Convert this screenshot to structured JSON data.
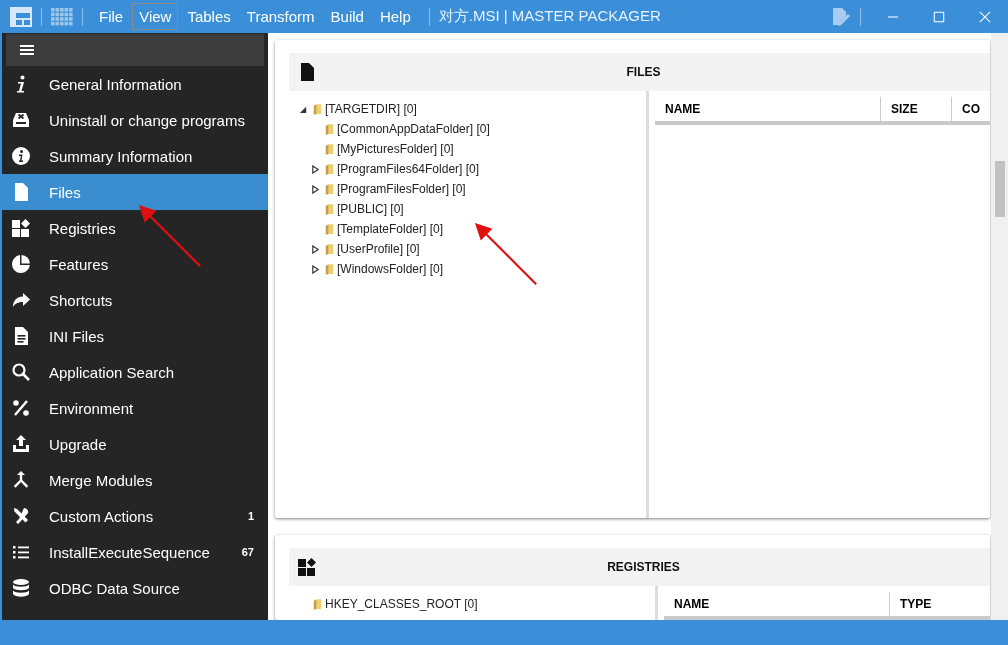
{
  "window": {
    "title": "对方.MSI | MASTER PACKAGER"
  },
  "menu": [
    {
      "label": "File",
      "selected": false
    },
    {
      "label": "View",
      "selected": true
    },
    {
      "label": "Tables",
      "selected": false
    },
    {
      "label": "Transform",
      "selected": false
    },
    {
      "label": "Build",
      "selected": false
    },
    {
      "label": "Help",
      "selected": false
    }
  ],
  "sidebar": {
    "items": [
      {
        "label": "General Information",
        "kind": "info-letter",
        "selected": false
      },
      {
        "label": "Uninstall or change programs",
        "kind": "uninstall",
        "selected": false
      },
      {
        "label": "Summary Information",
        "kind": "info-circle",
        "selected": false
      },
      {
        "label": "Files",
        "kind": "file",
        "selected": true
      },
      {
        "label": "Registries",
        "kind": "registry",
        "selected": false
      },
      {
        "label": "Features",
        "kind": "pie",
        "selected": false
      },
      {
        "label": "Shortcuts",
        "kind": "share",
        "selected": false
      },
      {
        "label": "INI Files",
        "kind": "doc",
        "selected": false
      },
      {
        "label": "Application Search",
        "kind": "search",
        "selected": false
      },
      {
        "label": "Environment",
        "kind": "percent",
        "selected": false
      },
      {
        "label": "Upgrade",
        "kind": "upload",
        "selected": false
      },
      {
        "label": "Merge Modules",
        "kind": "merge",
        "selected": false
      },
      {
        "label": "Custom Actions",
        "kind": "tools",
        "selected": false,
        "badge": "1"
      },
      {
        "label": "InstallExecuteSequence",
        "kind": "list",
        "selected": false,
        "badge": "67"
      },
      {
        "label": "ODBC Data Source",
        "kind": "database",
        "selected": false
      }
    ]
  },
  "files": {
    "title": "FILES",
    "tree": [
      {
        "label": "[TARGETDIR] [0]",
        "expanded": true,
        "children": [
          {
            "label": "[CommonAppDataFolder] [0]"
          },
          {
            "label": "[MyPicturesFolder] [0]"
          },
          {
            "label": "[ProgramFiles64Folder] [0]",
            "expanded": false
          },
          {
            "label": "[ProgramFilesFolder] [0]",
            "expanded": false
          },
          {
            "label": "[PUBLIC] [0]"
          },
          {
            "label": "[TemplateFolder] [0]"
          },
          {
            "label": "[UserProfile] [0]",
            "expanded": false
          },
          {
            "label": "[WindowsFolder] [0]",
            "expanded": false
          }
        ]
      }
    ],
    "columns": [
      "NAME",
      "SIZE",
      "CO"
    ]
  },
  "registries": {
    "title": "REGISTRIES",
    "tree": [
      {
        "label": "HKEY_CLASSES_ROOT [0]"
      }
    ],
    "columns": [
      "NAME",
      "TYPE"
    ]
  }
}
